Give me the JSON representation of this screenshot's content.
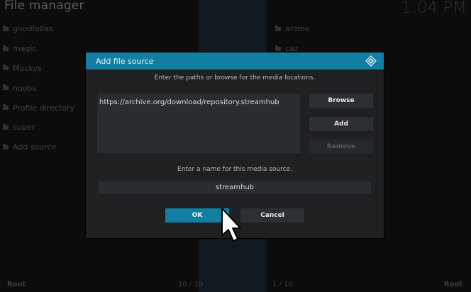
{
  "header": {
    "title": "File manager",
    "clock": "1:04 PM"
  },
  "left_list": [
    "goodfellas",
    "magic",
    "Muckys",
    "noobs",
    "Profile directory",
    "super",
    "Add source"
  ],
  "right_list": [
    "anime",
    "caz"
  ],
  "footer": {
    "left": "Root",
    "left_count": "10 / 10",
    "right_count": "1 / 10",
    "right": "Root"
  },
  "dialog": {
    "title": "Add file source",
    "instruction": "Enter the paths or browse for the media locations.",
    "path": "https://archive.org/download/repository.streamhub",
    "browse": "Browse",
    "add": "Add",
    "remove": "Remove",
    "name_label": "Enter a name for this media source.",
    "name_value": "streamhub",
    "ok": "OK",
    "cancel": "Cancel"
  },
  "colors": {
    "accent": "#127fa2",
    "dialog_bg": "#1e2022",
    "background": "#0c0c0d"
  },
  "icons": {
    "kodi": "kodi-logo-icon",
    "folder": "folder-icon",
    "cursor": "mouse-pointer-icon"
  }
}
